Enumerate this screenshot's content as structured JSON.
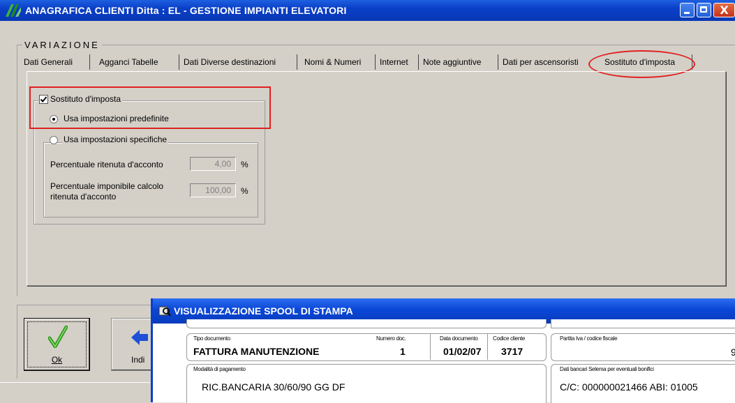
{
  "window": {
    "title": "ANAGRAFICA CLIENTI  Ditta : EL - GESTIONE IMPIANTI ELEVATORI",
    "close_glyph": "X"
  },
  "group": {
    "label": "VARIAZIONE"
  },
  "tabs": [
    {
      "label": "Dati Generali"
    },
    {
      "label": "Agganci Tabelle"
    },
    {
      "label": "Dati Diverse destinazioni"
    },
    {
      "label": "Nomi & Numeri"
    },
    {
      "label": "Internet"
    },
    {
      "label": "Note aggiuntive"
    },
    {
      "label": "Dati per ascensoristi"
    },
    {
      "label": "Sostituto d'imposta",
      "active": true
    }
  ],
  "sostituto": {
    "checkbox_label": "Sostituto d'imposta",
    "checked": true,
    "radio_default_label": "Usa impostazioni predefinite",
    "radio_specific_label": "Usa impostazioni specifiche",
    "ritenuta_label": "Percentuale ritenuta d'acconto",
    "ritenuta_value": "4,00",
    "imponibile_label_1": "Percentuale imponibile calcolo",
    "imponibile_label_2": "ritenuta d'acconto",
    "imponibile_value": "100,00",
    "percent_symbol": "%"
  },
  "buttons": {
    "ok_label": "Ok",
    "indietro_label": "Indi"
  },
  "spool": {
    "title": "VISUALIZZAZIONE SPOOL DI STAMPA",
    "tipo_documento_label": "Tipo documento",
    "tipo_documento_value": "FATTURA MANUTENZIONE",
    "numero_doc_label": "Numero doc.",
    "numero_doc_value": "1",
    "data_documento_label": "Data documento",
    "data_documento_value": "01/02/07",
    "codice_cliente_label": "Codice cliente",
    "codice_cliente_value": "3717",
    "partita_iva_label": "Partita Iva / codice fiscale",
    "partita_iva_value": "9",
    "modalita_label": "Modalità di pagamento",
    "modalita_value": "RIC.BANCARIA 30/60/90 GG DF",
    "dati_bancari_label": "Dati bancari Selema per eventuali bonifici",
    "dati_bancari_value": "C/C: 000000021466   ABI: 01005"
  },
  "colors": {
    "title_bar": "#0a3fc8",
    "annotation_red": "#e02020",
    "dialog_face": "#d4d0c8"
  }
}
